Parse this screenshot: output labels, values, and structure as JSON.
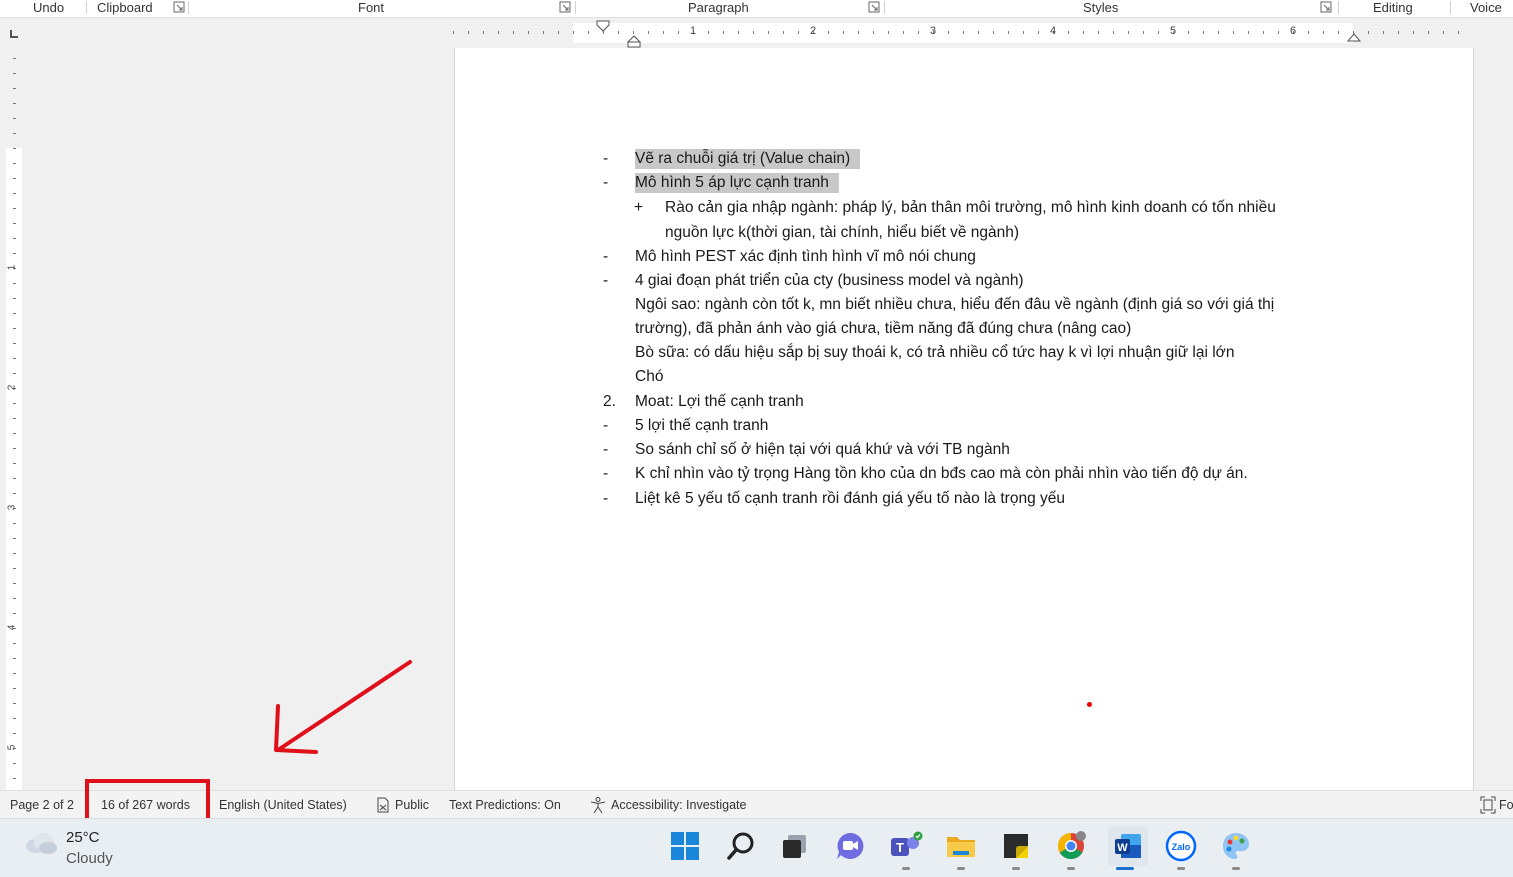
{
  "ribbon": {
    "groups": [
      "Undo",
      "Clipboard",
      "Font",
      "Paragraph",
      "Styles",
      "Editing",
      "Voice"
    ]
  },
  "ruler": {
    "numbers": [
      "1",
      "2",
      "3",
      "4",
      "5",
      "6"
    ],
    "vertical_numbers": [
      "1",
      "2",
      "3",
      "4",
      "5"
    ]
  },
  "document": {
    "lines": [
      {
        "marker": "-",
        "text": "Vẽ ra chuỗi giá trị (Value chain)",
        "highlight": true
      },
      {
        "marker": "-",
        "text": "Mô hình 5 áp lực cạnh tranh",
        "highlight": true
      },
      {
        "marker": "+",
        "text": "Rào cản gia nhập ngành: pháp lý, bản thân môi trường, mô hình kinh doanh có tốn nhiều"
      },
      {
        "marker": "",
        "text": "nguồn lực k(thời gian, tài chính, hiểu biết về ngành)"
      },
      {
        "marker": "-",
        "text": "Mô hình PEST xác định tình hình vĩ mô nói chung"
      },
      {
        "marker": "-",
        "text": "4 giai đoạn phát triển của cty (business model và ngành)"
      },
      {
        "marker": "",
        "text": "Ngôi sao: ngành còn tốt k, mn biết nhiều chưa, hiểu đến đâu về ngành (định giá so với giá thị"
      },
      {
        "marker": "",
        "text": "trường), đã phản ánh vào giá chưa, tiềm năng đã đúng chưa (nâng cao)"
      },
      {
        "marker": "",
        "text": "Bò sữa: có dấu hiệu sắp bị suy thoái k, có trả nhiều cổ tức hay k vì lợi nhuận giữ lại lớn"
      },
      {
        "marker": "",
        "text": "Chó"
      },
      {
        "marker": "2.",
        "text": "Moat: Lợi thế cạnh tranh"
      },
      {
        "marker": "-",
        "text": "5 lợi thế cạnh tranh"
      },
      {
        "marker": "-",
        "text": "So sánh chỉ số ở hiện tại với quá khứ và với TB ngành"
      },
      {
        "marker": "-",
        "text": "K chỉ nhìn vào tỷ trọng Hàng tồn kho của dn bđs cao mà còn phải nhìn vào tiến độ dự án."
      },
      {
        "marker": "-",
        "text": "Liệt kê 5 yếu tố cạnh tranh rồi đánh giá yếu tố nào là trọng yếu"
      }
    ]
  },
  "status": {
    "page": "Page 2 of 2",
    "words": "16 of 267 words",
    "language": "English (United States)",
    "sensitivity": "Public",
    "predictions": "Text Predictions: On",
    "accessibility": "Accessibility: Investigate",
    "focus": "Fo"
  },
  "taskbar": {
    "temperature": "25°C",
    "condition": "Cloudy",
    "apps": [
      "start",
      "search",
      "task-view",
      "chat",
      "teams",
      "file-explorer",
      "sticky-notes",
      "chrome",
      "word",
      "zalo",
      "paint"
    ]
  },
  "annotation": {
    "color": "#e0101a"
  }
}
